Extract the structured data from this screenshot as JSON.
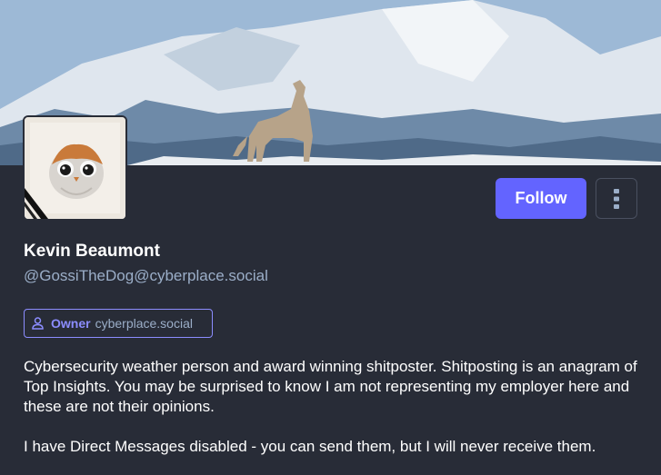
{
  "profile": {
    "display_name": "Kevin Beaumont",
    "handle": "@GossiTheDog@cyberplace.social",
    "header_image": "snowy-mountain-with-coyote",
    "avatar_image": "porg-watercolor"
  },
  "actions": {
    "follow_label": "Follow",
    "more_icon": "vertical-ellipsis-icon"
  },
  "role_badge": {
    "icon": "user-icon",
    "label": "Owner",
    "domain": "cyberplace.social"
  },
  "bio": {
    "paragraph_1": "Cybersecurity weather person and award winning shitposter. Shitposting is an anagram of Top Insights. You may be surprised to know I am not representing my employer here and these are not their opinions.",
    "paragraph_2": "I have Direct Messages disabled - you can send them, but I will never receive them."
  },
  "colors": {
    "background": "#282c37",
    "accent": "#6364ff",
    "badge_accent": "#8c8dff",
    "muted_text": "#9baec8"
  }
}
